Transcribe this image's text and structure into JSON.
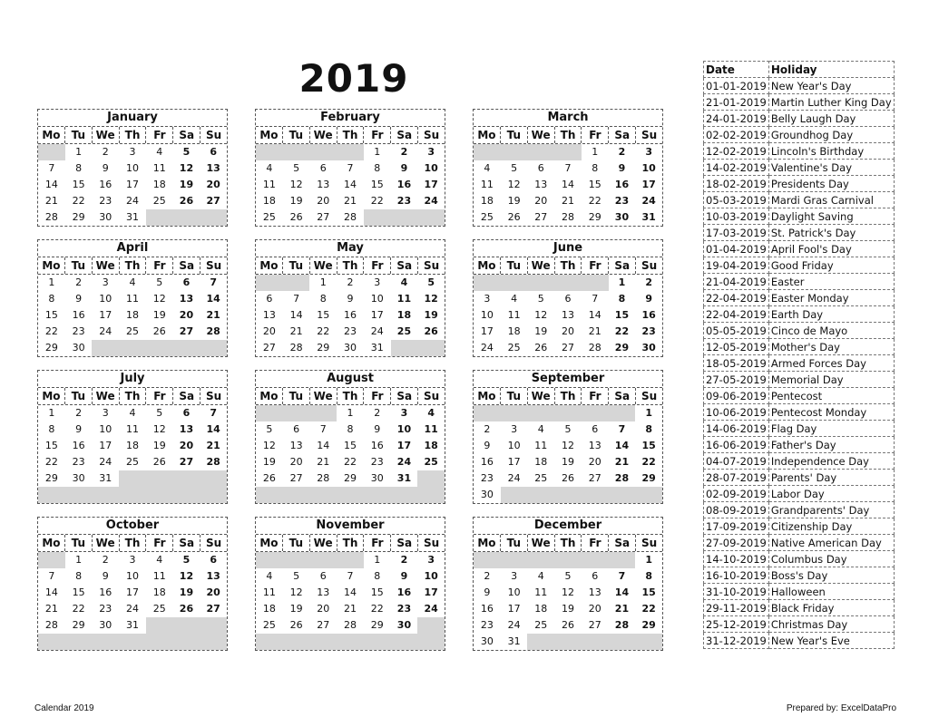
{
  "year": "2019",
  "weekdays": [
    "Mo",
    "Tu",
    "We",
    "Th",
    "Fr",
    "Sa",
    "Su"
  ],
  "months": [
    {
      "name": "January",
      "offset": 1,
      "days": 31
    },
    {
      "name": "February",
      "offset": 4,
      "days": 28
    },
    {
      "name": "March",
      "offset": 4,
      "days": 31
    },
    {
      "name": "April",
      "offset": 0,
      "days": 30
    },
    {
      "name": "May",
      "offset": 2,
      "days": 31
    },
    {
      "name": "June",
      "offset": 5,
      "days": 30
    },
    {
      "name": "July",
      "offset": 0,
      "days": 31
    },
    {
      "name": "August",
      "offset": 3,
      "days": 31
    },
    {
      "name": "September",
      "offset": 6,
      "days": 30
    },
    {
      "name": "October",
      "offset": 1,
      "days": 31
    },
    {
      "name": "November",
      "offset": 4,
      "days": 30
    },
    {
      "name": "December",
      "offset": 6,
      "days": 31
    }
  ],
  "holidays": {
    "headers": {
      "date": "Date",
      "holiday": "Holiday"
    },
    "rows": [
      {
        "date": "01-01-2019",
        "name": "New Year's Day"
      },
      {
        "date": "21-01-2019",
        "name": "Martin Luther King Day"
      },
      {
        "date": "24-01-2019",
        "name": "Belly Laugh Day"
      },
      {
        "date": "02-02-2019",
        "name": "Groundhog Day"
      },
      {
        "date": "12-02-2019",
        "name": "Lincoln's Birthday"
      },
      {
        "date": "14-02-2019",
        "name": "Valentine's Day"
      },
      {
        "date": "18-02-2019",
        "name": "Presidents Day"
      },
      {
        "date": "05-03-2019",
        "name": "Mardi Gras Carnival"
      },
      {
        "date": "10-03-2019",
        "name": "Daylight Saving"
      },
      {
        "date": "17-03-2019",
        "name": "St. Patrick's Day"
      },
      {
        "date": "01-04-2019",
        "name": "April Fool's Day"
      },
      {
        "date": "19-04-2019",
        "name": "Good Friday"
      },
      {
        "date": "21-04-2019",
        "name": "Easter"
      },
      {
        "date": "22-04-2019",
        "name": "Easter Monday"
      },
      {
        "date": "22-04-2019",
        "name": "Earth Day"
      },
      {
        "date": "05-05-2019",
        "name": "Cinco de Mayo"
      },
      {
        "date": "12-05-2019",
        "name": "Mother's Day"
      },
      {
        "date": "18-05-2019",
        "name": "Armed Forces Day"
      },
      {
        "date": "27-05-2019",
        "name": "Memorial Day"
      },
      {
        "date": "09-06-2019",
        "name": "Pentecost"
      },
      {
        "date": "10-06-2019",
        "name": "Pentecost Monday"
      },
      {
        "date": "14-06-2019",
        "name": "Flag Day"
      },
      {
        "date": "16-06-2019",
        "name": "Father's Day"
      },
      {
        "date": "04-07-2019",
        "name": "Independence Day"
      },
      {
        "date": "28-07-2019",
        "name": "Parents' Day"
      },
      {
        "date": "02-09-2019",
        "name": "Labor Day"
      },
      {
        "date": "08-09-2019",
        "name": "Grandparents' Day"
      },
      {
        "date": "17-09-2019",
        "name": "Citizenship Day"
      },
      {
        "date": "27-09-2019",
        "name": "Native American Day"
      },
      {
        "date": "14-10-2019",
        "name": "Columbus Day"
      },
      {
        "date": "16-10-2019",
        "name": "Boss's Day"
      },
      {
        "date": "31-10-2019",
        "name": "Halloween"
      },
      {
        "date": "29-11-2019",
        "name": "Black Friday"
      },
      {
        "date": "25-12-2019",
        "name": "Christmas Day"
      },
      {
        "date": "31-12-2019",
        "name": "New Year's Eve"
      }
    ]
  },
  "footer": {
    "left": "Calendar 2019",
    "right": "Prepared by: ExcelDataPro"
  }
}
